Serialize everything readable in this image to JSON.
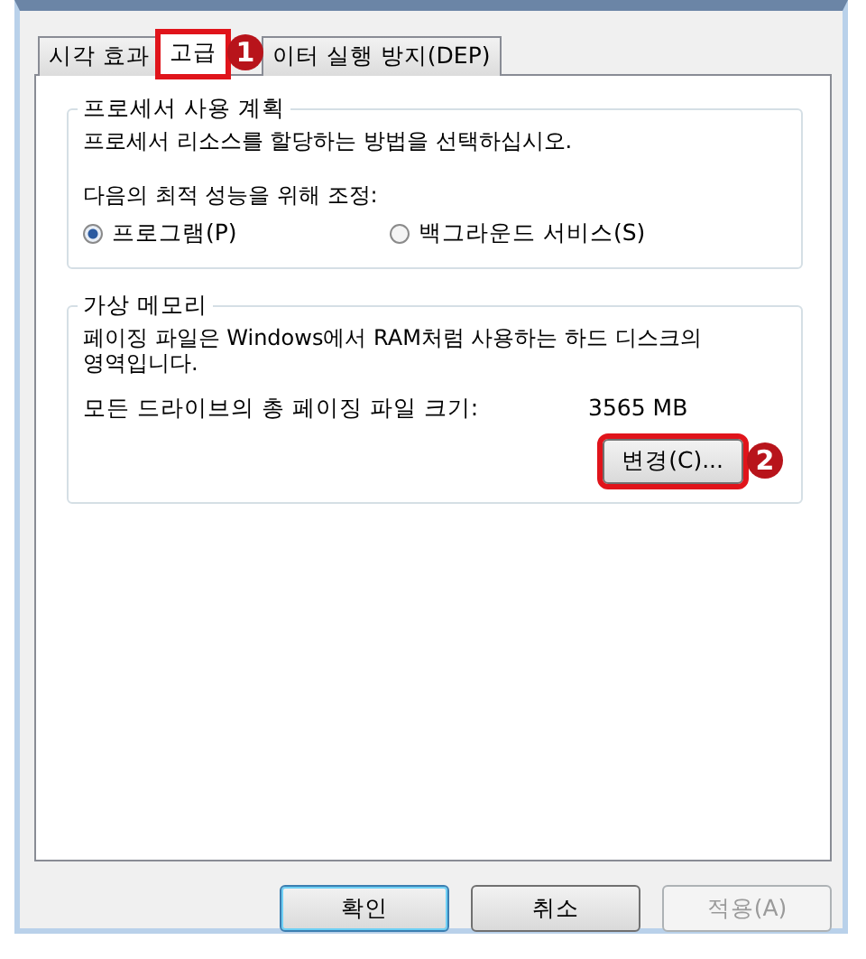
{
  "tabs": [
    {
      "label": "시각 효과",
      "selected": false
    },
    {
      "label": "고급",
      "selected": true,
      "badge": "1"
    },
    {
      "label": "이터 실행 방지(DEP)",
      "selected": false
    }
  ],
  "groups": [
    {
      "title": "프로세서 사용 계획",
      "lines": [
        "프로세서 리소스를 할당하는 방법을 선택하십시오."
      ],
      "prompt": "다음의 최적 성능을 위해 조정:",
      "radios": [
        {
          "label": "프로그램(P)",
          "selected": true
        },
        {
          "label": "백그라운드 서비스(S)",
          "selected": false
        }
      ]
    },
    {
      "title": "가상 메모리",
      "lines": [
        "페이징 파일은 Windows에서 RAM처럼 사용하는 하드 디스크의 영역입니다."
      ],
      "size_label": "모든 드라이브의 총 페이징 파일 크기:",
      "size_value": "3565 MB",
      "button": {
        "label": "변경(C)...",
        "badge": "2"
      }
    }
  ],
  "buttons": [
    {
      "label": "확인",
      "kind": "default",
      "disabled": false
    },
    {
      "label": "취소",
      "kind": "normal",
      "disabled": false
    },
    {
      "label": "적용(A)",
      "kind": "normal",
      "disabled": true
    }
  ]
}
